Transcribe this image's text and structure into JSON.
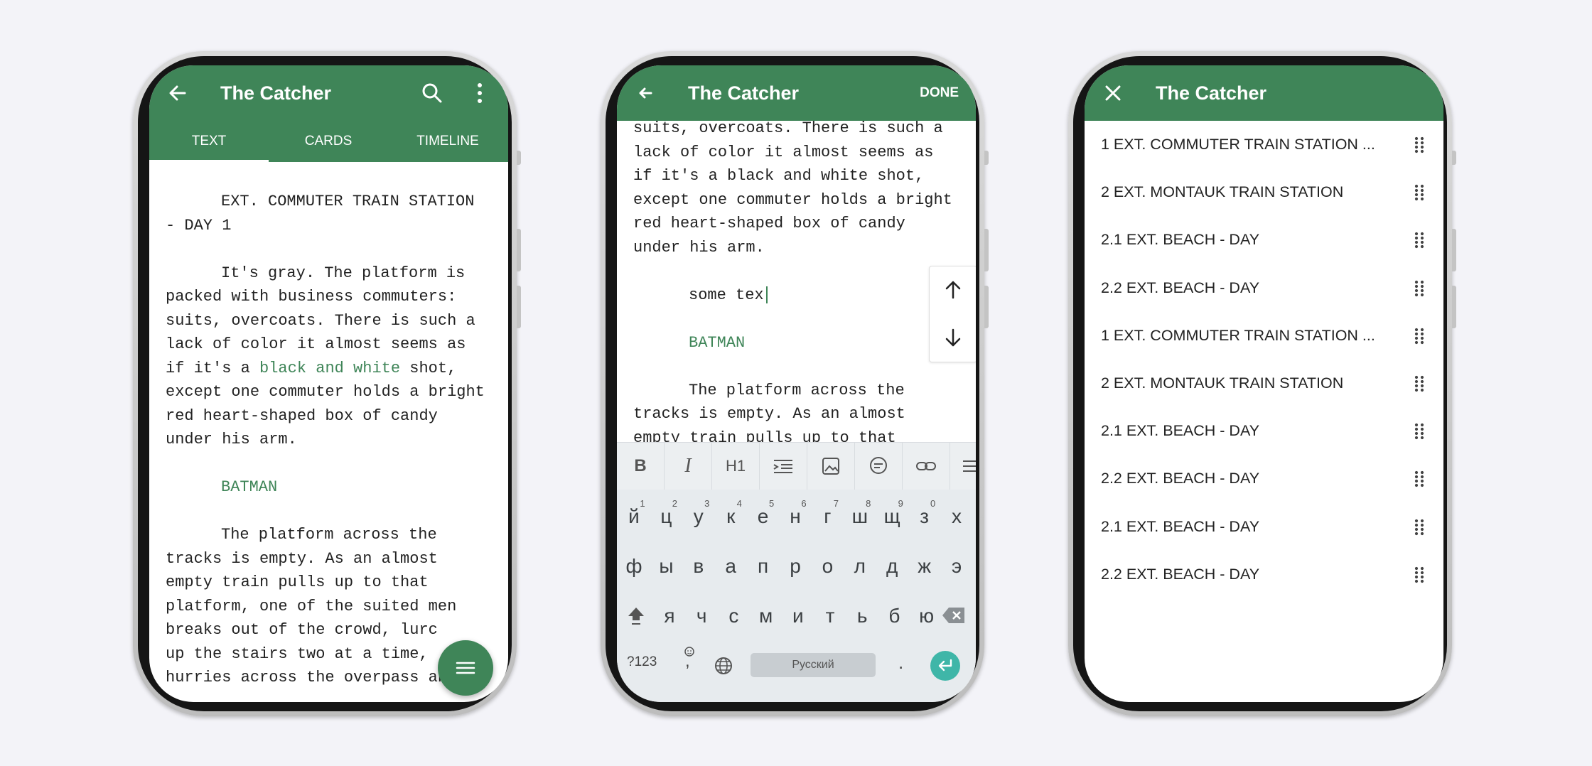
{
  "colors": {
    "primary": "#3f8558",
    "background": "#f3f3f8",
    "enter_key": "#3fb6a8"
  },
  "phone1": {
    "title": "The Catcher",
    "tabs": [
      "TEXT",
      "CARDS",
      "TIMELINE"
    ],
    "active_tab": "TEXT",
    "scene_heading": "EXT. COMMUTER TRAIN STATION",
    "scene_heading_2": "- DAY 1",
    "action1_line1": "It's gray. The platform is",
    "action1_line2": "packed with business commuters:",
    "action1_line3": "suits, overcoats. There is such a",
    "action1_line4": "lack of color it almost seems as",
    "action1_line5_pre": "if it's a ",
    "action1_line5_link": "black and white",
    "action1_line5_post": " shot,",
    "action1_line6": "except one commuter holds a bright",
    "action1_line7": "red heart-shaped box of candy",
    "action1_line8": "under his arm.",
    "character": "BATMAN",
    "action2_line1": "The platform across the",
    "action2_line2": "tracks is empty. As an almost",
    "action2_line3": "empty train pulls up to that",
    "action2_line4": "platform, one of the suited men",
    "action2_line5": "breaks out of the crowd, lurc",
    "action2_line6": "up the stairs two at a time,",
    "action2_line7": "hurries across the overpass and"
  },
  "phone2": {
    "title": "The Catcher",
    "done_label": "DONE",
    "lines": [
      "suits, overcoats. There is such a",
      "lack of color it almost seems as",
      "if it's a black and white shot,",
      "except one commuter holds a bright",
      "red heart-shaped box of candy",
      "under his arm."
    ],
    "typed_text": "some tex",
    "character": "BATMAN",
    "action2_line1": "The platform across the",
    "action2_line2": "tracks is empty. As an almost",
    "action2_line3": "empty train pulls up to that",
    "format_buttons": [
      "bold-icon",
      "italic-icon",
      "H1",
      "indent-icon",
      "image-icon",
      "comment-icon",
      "link-icon",
      "list-icon"
    ],
    "h1_label": "H1",
    "keyboard": {
      "row1": [
        "й",
        "ц",
        "у",
        "к",
        "е",
        "н",
        "г",
        "ш",
        "щ",
        "з",
        "х"
      ],
      "row1_hints": [
        "1",
        "2",
        "3",
        "4",
        "5",
        "6",
        "7",
        "8",
        "9",
        "0",
        ""
      ],
      "row2": [
        "ф",
        "ы",
        "в",
        "а",
        "п",
        "р",
        "о",
        "л",
        "д",
        "ж",
        "э"
      ],
      "row3": [
        "я",
        "ч",
        "с",
        "м",
        "и",
        "т",
        "ь",
        "б",
        "ю"
      ],
      "symbols_label": "?123",
      "comma_label": ",",
      "space_label": "Русский",
      "period_label": "."
    }
  },
  "phone3": {
    "title": "The Catcher",
    "scenes": [
      "1 EXT. COMMUTER TRAIN STATION  ...",
      "2 EXT. MONTAUK TRAIN STATION",
      "2.1 EXT. BEACH - DAY",
      "2.2 EXT. BEACH - DAY",
      "1 EXT. COMMUTER TRAIN STATION  ...",
      "2 EXT. MONTAUK TRAIN STATION",
      "2.1 EXT. BEACH - DAY",
      "2.2 EXT. BEACH - DAY",
      "2.1 EXT. BEACH - DAY",
      "2.2 EXT. BEACH - DAY"
    ]
  }
}
